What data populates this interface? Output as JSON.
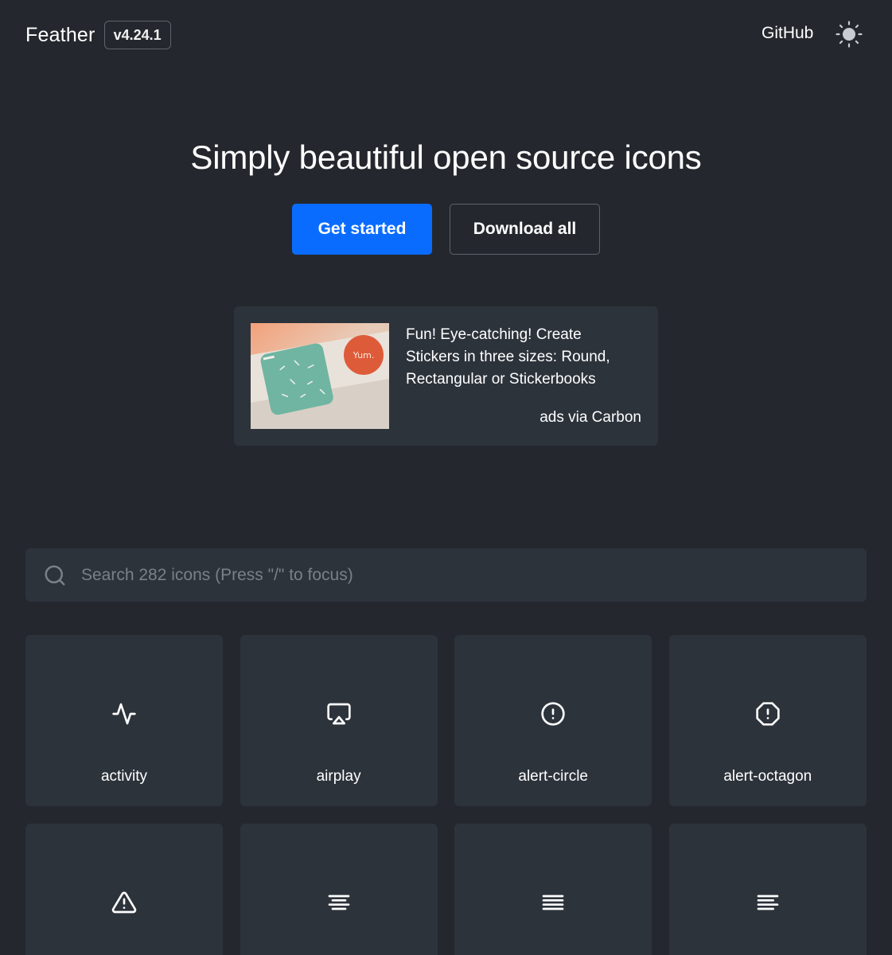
{
  "header": {
    "brand": "Feather",
    "version": "v4.24.1",
    "github_label": "GitHub",
    "theme_icon": "sun-icon"
  },
  "hero": {
    "title": "Simply beautiful open source icons",
    "primary_button": "Get started",
    "secondary_button": "Download all"
  },
  "ad": {
    "text": "Fun! Eye-catching! Create Stickers in three sizes: Round, Rectangular or Stickerbooks",
    "via": "ads via Carbon",
    "image_brand": "Yum."
  },
  "search": {
    "placeholder": "Search 282 icons (Press \"/\" to focus)",
    "value": ""
  },
  "icons": [
    {
      "label": "activity",
      "icon": "activity-icon"
    },
    {
      "label": "airplay",
      "icon": "airplay-icon"
    },
    {
      "label": "alert-circle",
      "icon": "alert-circle-icon"
    },
    {
      "label": "alert-octagon",
      "icon": "alert-octagon-icon"
    },
    {
      "label": "",
      "icon": "alert-triangle-icon"
    },
    {
      "label": "",
      "icon": "align-center-icon"
    },
    {
      "label": "",
      "icon": "align-justify-icon"
    },
    {
      "label": "",
      "icon": "align-left-icon"
    }
  ],
  "colors": {
    "background": "#24282e",
    "card": "#2d333b",
    "primary": "#0a6cff",
    "border": "#5d636c"
  }
}
